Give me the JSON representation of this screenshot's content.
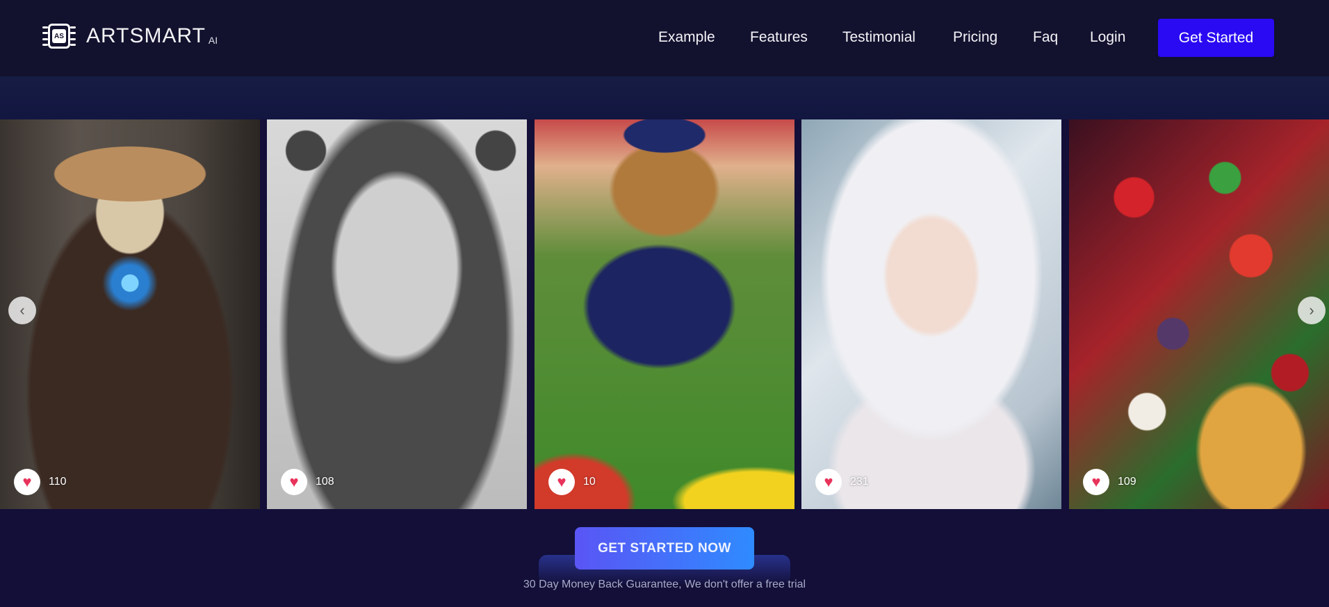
{
  "brand": {
    "logo_badge": "AS",
    "name": "ARTSMART",
    "suffix": "AI"
  },
  "nav": {
    "items": [
      {
        "label": "Example"
      },
      {
        "label": "Features"
      },
      {
        "label": "Testimonial"
      },
      {
        "label": "Pricing"
      },
      {
        "label": "Faq"
      },
      {
        "label": "Login"
      }
    ],
    "cta_label": "Get Started",
    "cta_color": "#2a0af2"
  },
  "gallery": {
    "cards": [
      {
        "subject": "skeleton cowboy with glowing core",
        "likes": "110"
      },
      {
        "subject": "pencil sketch portrait of woman with flowers",
        "likes": "108"
      },
      {
        "subject": "cat in football jersey on soccer field",
        "likes": "10"
      },
      {
        "subject": "white-haired fox-eared anime girl",
        "likes": "231"
      },
      {
        "subject": "berries and cream ice cream cone",
        "likes": "109"
      }
    ],
    "prev_icon": "chevron-left-icon",
    "next_icon": "chevron-right-icon",
    "like_icon": "heart-icon",
    "like_color": "#e8335a"
  },
  "cta": {
    "label": "GET STARTED NOW",
    "note": "30 Day Money Back Guarantee, We don't offer a free trial"
  }
}
